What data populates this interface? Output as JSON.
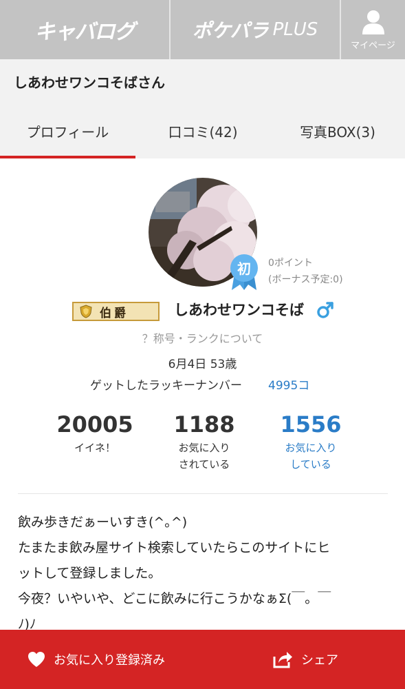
{
  "nav": {
    "logo1": "キャバログ",
    "logo2_main": "ポケパラ",
    "logo2_plus": "PLUS",
    "mypage_label": "マイページ"
  },
  "profile_header": {
    "username": "しあわせワンコそばさん"
  },
  "tabs": [
    {
      "label": "プロフィール",
      "active": true
    },
    {
      "label": "口コミ(42)",
      "active": false
    },
    {
      "label": "写真BOX(3)",
      "active": false
    }
  ],
  "profile": {
    "first_badge": "初",
    "points": "0ポイント",
    "bonus": "(ボーナス予定:0)",
    "rank": "伯爵",
    "nickname": "しあわせワンコそば",
    "gender": "male",
    "rank_link": "？称号・ランクについて",
    "birth_age": "6月4日 53歳",
    "lucky_label": "ゲットしたラッキーナンバー",
    "lucky_value": "4995コ"
  },
  "stats": [
    {
      "value": "20005",
      "label1": "イイネ！",
      "label2": ""
    },
    {
      "value": "1188",
      "label1": "お気に入り",
      "label2": "されている"
    },
    {
      "value": "1556",
      "label1": "お気に入り",
      "label2": "している"
    }
  ],
  "bio": [
    "飲み歩きだぁーいすき(^｡^)",
    "たまたま飲み屋サイト検索していたらこのサイトにヒ",
    "ットして登録しました。",
    "今夜？いやいや、どこに飲みに行こうかなぁΣ(￣。￣",
    "ﾉ)ﾉ"
  ],
  "bottom": {
    "fav_label": "お気に入り登録済み",
    "share_label": "シェア"
  },
  "colors": {
    "accent_red": "#d42424",
    "link_blue": "#2a7cc7",
    "nav_gray": "#c3c3c3"
  }
}
